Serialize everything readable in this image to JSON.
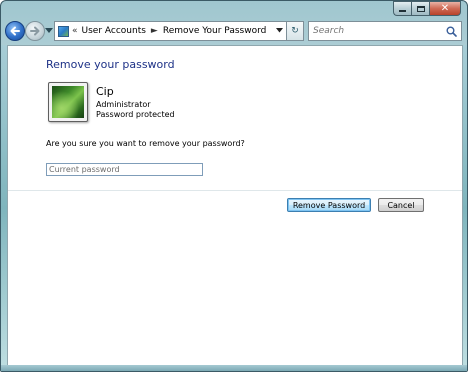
{
  "window": {
    "caption": {
      "minimize_icon": "minimize-icon",
      "maximize_icon": "maximize-icon",
      "close_icon": "close-icon",
      "close_glyph": "✕"
    }
  },
  "navigation": {
    "back_icon": "arrow-left-icon",
    "forward_icon": "arrow-right-icon",
    "address": {
      "chevron": "«",
      "crumbs": [
        "User Accounts",
        "Remove Your Password"
      ],
      "separator": "►"
    },
    "refresh_glyph": "↻",
    "search": {
      "placeholder": "Search"
    }
  },
  "page": {
    "title": "Remove your password",
    "user": {
      "name": "Cip",
      "role": "Administrator",
      "status": "Password protected"
    },
    "question": "Are you sure you want to remove your password?",
    "password_field": {
      "placeholder": "Current password",
      "value": ""
    },
    "buttons": {
      "remove": "Remove Password",
      "cancel": "Cancel"
    }
  },
  "colors": {
    "title": "#1e3287",
    "glass": "#9fc6cf",
    "primary_button_border": "#3c7fb1"
  }
}
